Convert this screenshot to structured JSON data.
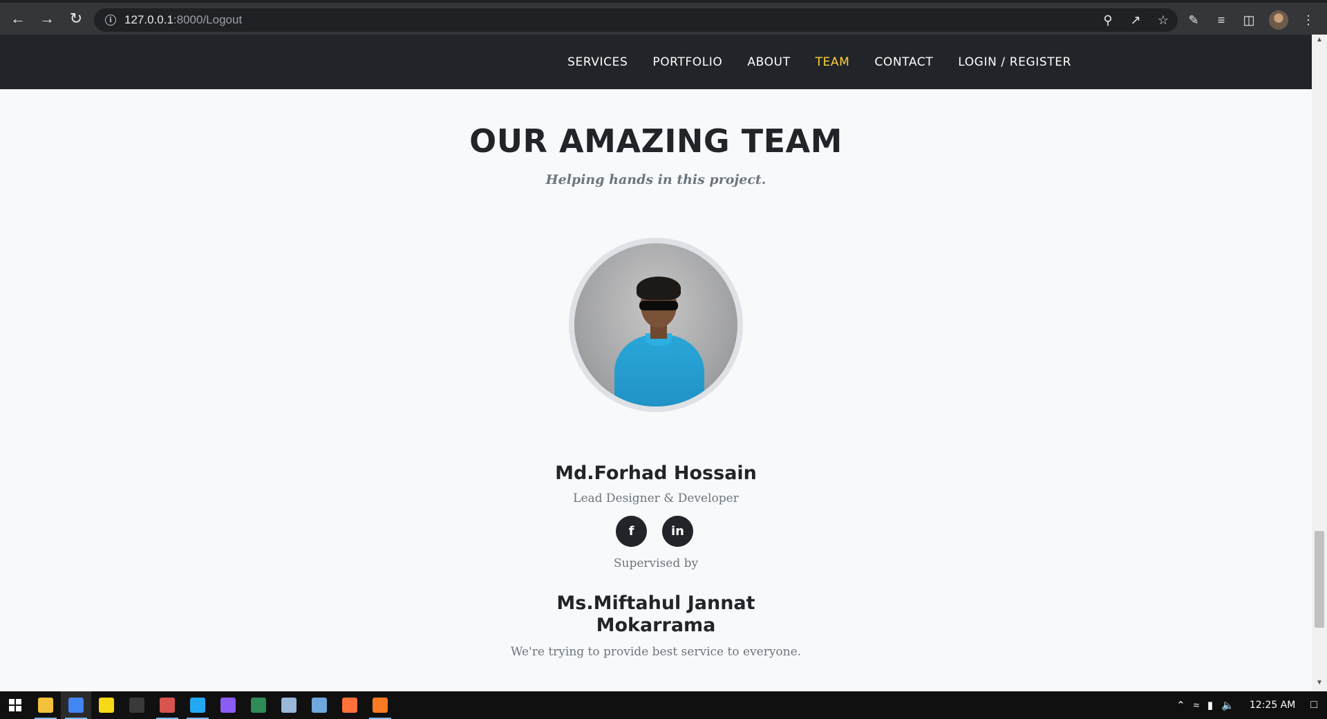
{
  "browser": {
    "url_host": "127.0.0.1",
    "url_rest": ":8000/Logout",
    "nav_icons": [
      "back-arrow-icon",
      "forward-arrow-icon",
      "reload-icon"
    ],
    "omnibox_icons": [
      "zoom-icon",
      "share-icon",
      "bookmark-star-icon"
    ],
    "toolbar_icons": [
      "extensions-icon",
      "reading-list-icon",
      "side-panel-icon",
      "profile-avatar",
      "menu-icon"
    ]
  },
  "site_nav": {
    "links": [
      {
        "label": "SERVICES",
        "active": false
      },
      {
        "label": "PORTFOLIO",
        "active": false
      },
      {
        "label": "ABOUT",
        "active": false
      },
      {
        "label": "TEAM",
        "active": true
      },
      {
        "label": "CONTACT",
        "active": false
      },
      {
        "label": "LOGIN / REGISTER",
        "active": false
      }
    ],
    "active_color": "#fed136"
  },
  "team": {
    "title": "OUR AMAZING TEAM",
    "subtitle": "Helping hands in this project.",
    "member": {
      "name": "Md.Forhad Hossain",
      "role": "Lead Designer & Developer",
      "social": [
        {
          "icon": "facebook-icon",
          "glyph": "f"
        },
        {
          "icon": "linkedin-icon",
          "glyph": "in"
        }
      ]
    },
    "supervised_label": "Supervised by",
    "supervisor": {
      "name_line1": "Ms.Miftahul Jannat",
      "name_line2": "Mokarrama"
    },
    "tagline": "We're trying to provide best service to everyone."
  },
  "taskbar": {
    "apps": [
      {
        "name": "file-explorer-icon",
        "color": "#f3c13a",
        "running": true
      },
      {
        "name": "chrome-icon",
        "color": "#4285f4",
        "running": true,
        "active": true
      },
      {
        "name": "sticky-notes-icon",
        "color": "#f7d917",
        "running": false
      },
      {
        "name": "terminal-icon",
        "color": "#3a3a3a",
        "running": false
      },
      {
        "name": "app-icon",
        "color": "#d9534f",
        "running": true
      },
      {
        "name": "vscode-icon",
        "color": "#23a9f2",
        "running": true
      },
      {
        "name": "messenger-icon",
        "color": "#8b5cf6",
        "running": false
      },
      {
        "name": "app-icon-2",
        "color": "#2e8b57",
        "running": false
      },
      {
        "name": "notepad-icon",
        "color": "#9ab8d8",
        "running": false
      },
      {
        "name": "app-icon-3",
        "color": "#6fa8dc",
        "running": false
      },
      {
        "name": "firefox-icon",
        "color": "#ff7139",
        "running": false
      },
      {
        "name": "xampp-icon",
        "color": "#fb7a24",
        "running": true
      }
    ],
    "clock": "12:25 AM"
  }
}
